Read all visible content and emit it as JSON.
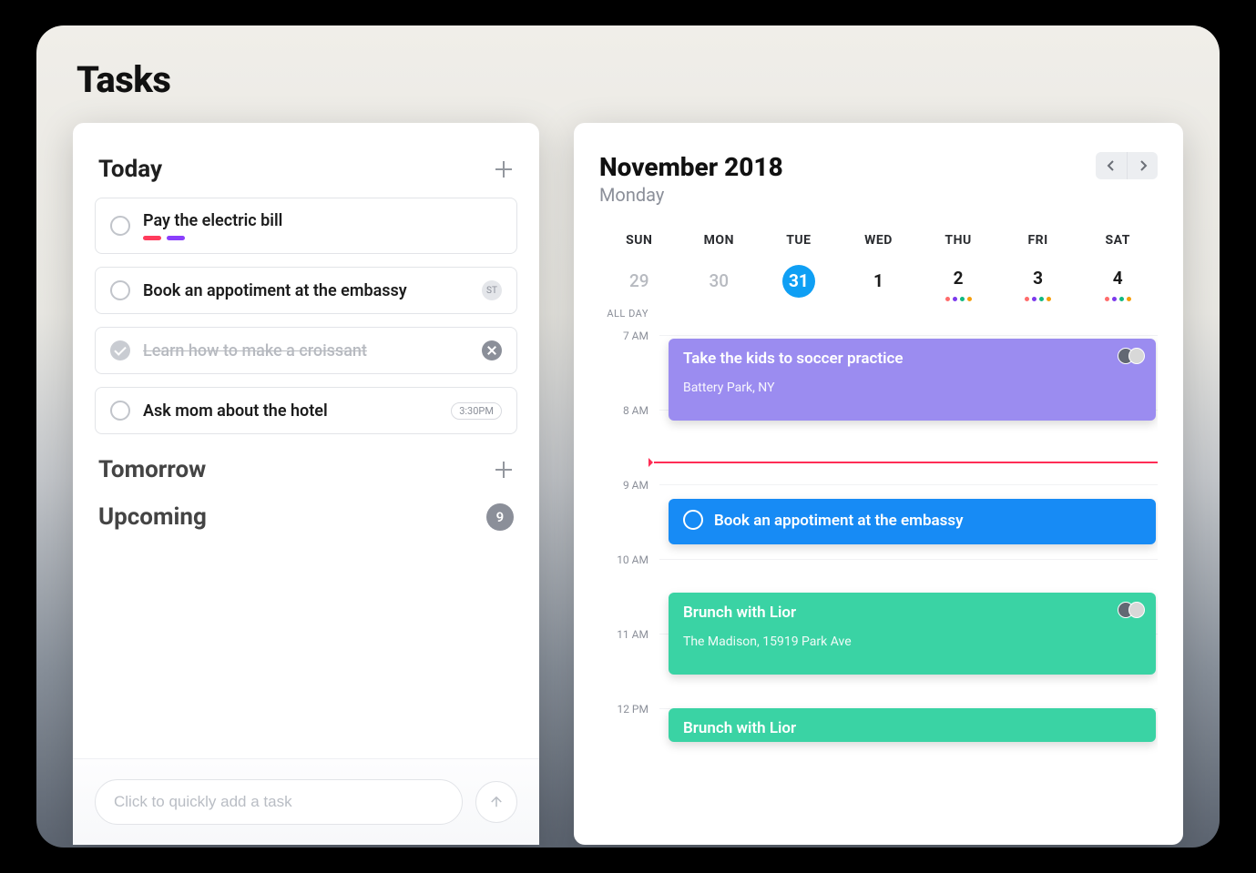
{
  "page_title": "Tasks",
  "sections": {
    "today": {
      "label": "Today"
    },
    "tomorrow": {
      "label": "Tomorrow"
    },
    "upcoming": {
      "label": "Upcoming",
      "count": "9"
    }
  },
  "tasks": {
    "today": [
      {
        "title": "Pay the electric bill",
        "tags": [
          "#ff3b5c",
          "#8a3ffc"
        ]
      },
      {
        "title": "Book an appotiment at the embassy",
        "badge": "ST"
      },
      {
        "title": "Learn how to make a croissant",
        "completed": true,
        "deletable": true
      },
      {
        "title": "Ask mom about the hotel",
        "time": "3:30PM"
      }
    ]
  },
  "quick_add": {
    "placeholder": "Click to quickly add a task"
  },
  "calendar": {
    "month_year": "November 2018",
    "day_name": "Monday",
    "dow": [
      "SUN",
      "MON",
      "TUE",
      "WED",
      "THU",
      "FRI",
      "SAT"
    ],
    "allday_label": "ALL DAY",
    "dates": [
      {
        "num": "29",
        "dim": true
      },
      {
        "num": "30",
        "dim": true
      },
      {
        "num": "31",
        "selected": true
      },
      {
        "num": "1"
      },
      {
        "num": "2",
        "dots": [
          "#ff6b6b",
          "#7c3aed",
          "#10b981",
          "#f59e0b"
        ]
      },
      {
        "num": "3",
        "dots": [
          "#ff6b6b",
          "#7c3aed",
          "#10b981",
          "#f59e0b"
        ]
      },
      {
        "num": "4",
        "dots": [
          "#ff6b6b",
          "#7c3aed",
          "#10b981",
          "#f59e0b"
        ]
      }
    ],
    "hours": [
      "7 AM",
      "8 AM",
      "9 AM",
      "10 AM",
      "11 AM",
      "12 PM"
    ],
    "now_after_hour_index": 1.7,
    "hour_height": 82,
    "events": [
      {
        "title": "Take the kids to soccer practice",
        "location": "Battery Park, NY",
        "color": "#9b8cf0",
        "start_idx": 0.05,
        "span": 1.1,
        "avatars": 2
      },
      {
        "title": "Book an appotiment at the embassy",
        "ring": true,
        "color": "#178bf5",
        "start_idx": 2.2,
        "span": 0.6
      },
      {
        "title": "Brunch with Lior",
        "location": "The Madison, 15919 Park Ave",
        "color": "#3ad3a4",
        "start_idx": 3.45,
        "span": 1.1,
        "avatars": 2
      },
      {
        "title": "Brunch with Lior",
        "color": "#3ad3a4",
        "start_idx": 5.0,
        "span": 0.45
      }
    ]
  },
  "colors": {
    "accent_blue": "#178bf5",
    "accent_purple": "#9b8cf0",
    "accent_teal": "#3ad3a4",
    "danger": "#ff2d55"
  }
}
